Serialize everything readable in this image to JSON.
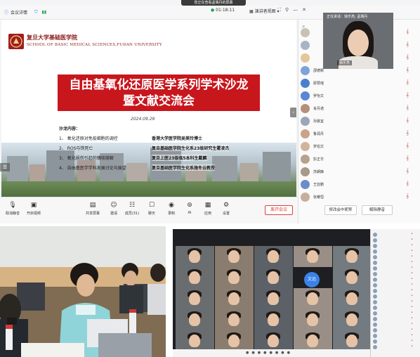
{
  "sharing_banner": "您正在查看孟瑀丹的屏幕",
  "titlebar": {
    "meeting_details": "会议详情",
    "timer": "01:18:11",
    "layout_button": "演讲者视图"
  },
  "slide": {
    "school_cn": "复旦大学基础医学院",
    "school_en": "SCHOOL OF BASIC MEDICAL SCIENCES,FUDAN UNIVERSITY",
    "title_line1": "自由基氧化还原医学系列学术沙龙",
    "title_line2": "暨文献交流会",
    "date": "2024.09.29",
    "content_label": "沙龙内容：",
    "agenda": [
      {
        "topic": "1、 氧化还原对免疫细胞的调控",
        "speaker": "香港大学医学院吴美玲博士"
      },
      {
        "topic": "2、 ROS与铁死亡",
        "speaker": "复旦基础医学院生化系23级研究生霍凌杰"
      },
      {
        "topic": "3、 氧化损伤引起的镶核崩解",
        "speaker": "复旦上医23级临5本科生戴麟"
      },
      {
        "topic": "4、 自由基医学学科发展讨论与展望",
        "speaker": "复旦基础医学院生化系施冬云教授"
      }
    ]
  },
  "speaker_tile": {
    "label": "正在讲话：徐乐亮; 孟瑀丹",
    "name": "徐乐亮"
  },
  "participants": [
    {
      "name": "",
      "color": "#c9c1b3"
    },
    {
      "name": "",
      "color": "#a9b4c3"
    },
    {
      "name": "",
      "color": "#e1c79a"
    },
    {
      "name": "邵德颖",
      "color": "#7ea3d9"
    },
    {
      "name": "廖慧瑶",
      "color": "#4a7fd0"
    },
    {
      "name": "罗怡文",
      "color": "#5b86d6"
    },
    {
      "name": "肖丹诺",
      "color": "#b58f7a"
    },
    {
      "name": "孙晨宜",
      "color": "#9aa7b8"
    },
    {
      "name": "鲁润丹",
      "color": "#caa389"
    },
    {
      "name": "罗伯文",
      "color": "#d4b39b"
    },
    {
      "name": "彭正华",
      "color": "#b8a28f"
    },
    {
      "name": "苏朗静",
      "color": "#a89988"
    },
    {
      "name": "王亚鹏",
      "color": "#6d8ccc"
    },
    {
      "name": "张耀恒",
      "color": "#c4b09a"
    }
  ],
  "toolbar": {
    "items": [
      {
        "label": "取消静音",
        "icon": "mic-off-icon"
      },
      {
        "label": "开启视频",
        "icon": "camera-off-icon"
      },
      {
        "label": "共享屏幕",
        "icon": "share-screen-icon"
      },
      {
        "label": "邀请",
        "icon": "invite-icon"
      },
      {
        "label": "成员(31)",
        "icon": "members-icon"
      },
      {
        "label": "聊天",
        "icon": "chat-icon"
      },
      {
        "label": "录制",
        "icon": "record-icon"
      },
      {
        "label": "AI",
        "icon": "ai-icon"
      },
      {
        "label": "应用",
        "icon": "apps-icon"
      },
      {
        "label": "设置",
        "icon": "settings-icon"
      }
    ],
    "leave_label": "离开会议",
    "message_label": "修改会中昵称",
    "unmute_all_label": "解除静音"
  },
  "gallery": {
    "avatar_text": "文远"
  },
  "colors": {
    "title_red": "#c8161d",
    "brand_blue": "#1e6ef0",
    "leave_red": "#e04040"
  }
}
